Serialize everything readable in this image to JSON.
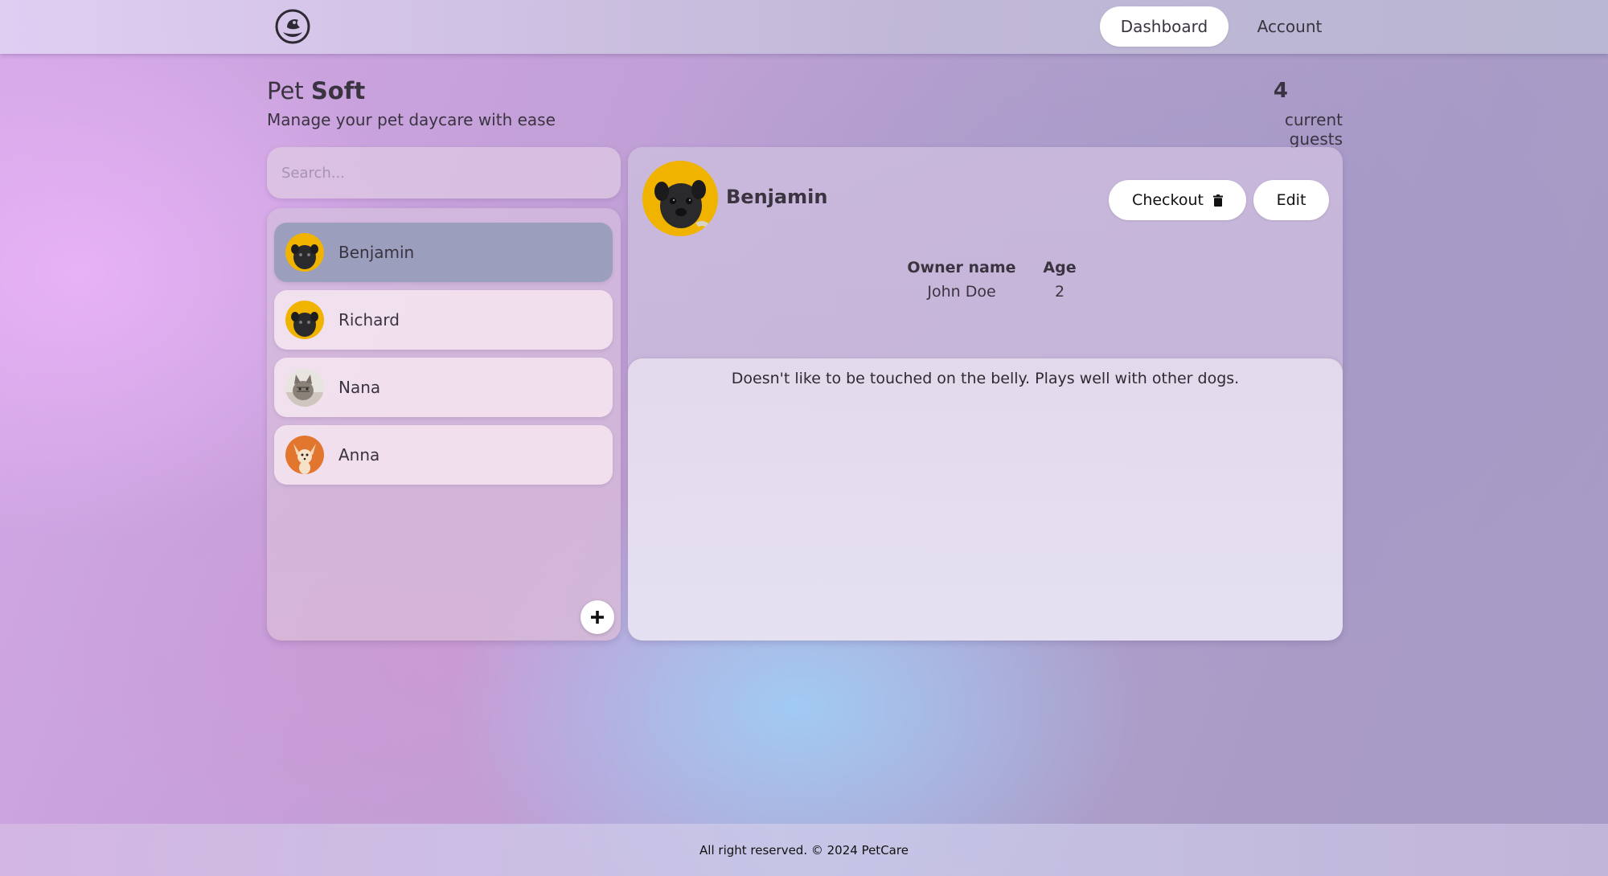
{
  "header": {
    "logo_icon": "paw-logo-icon",
    "nav": [
      {
        "label": "Dashboard",
        "active": true
      },
      {
        "label": "Account",
        "active": false
      }
    ]
  },
  "brand": {
    "prefix": "Pet",
    "emphasis": "Soft"
  },
  "subtitle": "Manage your pet daycare with ease",
  "stats": {
    "count": "4",
    "label": "current guests"
  },
  "search": {
    "placeholder": "Search...",
    "value": ""
  },
  "pets": [
    {
      "name": "Benjamin",
      "avatar": "pug-yellow",
      "selected": true
    },
    {
      "name": "Richard",
      "avatar": "pug-yellow",
      "selected": false
    },
    {
      "name": "Nana",
      "avatar": "cat-grey",
      "selected": false
    },
    {
      "name": "Anna",
      "avatar": "chihuahua-orange",
      "selected": false
    }
  ],
  "add_button_icon": "plus-icon",
  "details": {
    "name": "Benjamin",
    "checkout_label": "Checkout",
    "checkout_icon": "trash-icon",
    "edit_label": "Edit",
    "owner_label": "Owner name",
    "owner_value": "John Doe",
    "age_label": "Age",
    "age_value": "2",
    "notes": "Doesn't like to be touched on the belly. Plays well with other dogs."
  },
  "footer": {
    "text": "All right reserved. © 2024 PetCare"
  },
  "colors": {
    "selected_item": "#9b9fbd",
    "button_bg": "#ffffff",
    "avatar_yellow": "#f0b000",
    "avatar_orange": "#e2762e"
  }
}
